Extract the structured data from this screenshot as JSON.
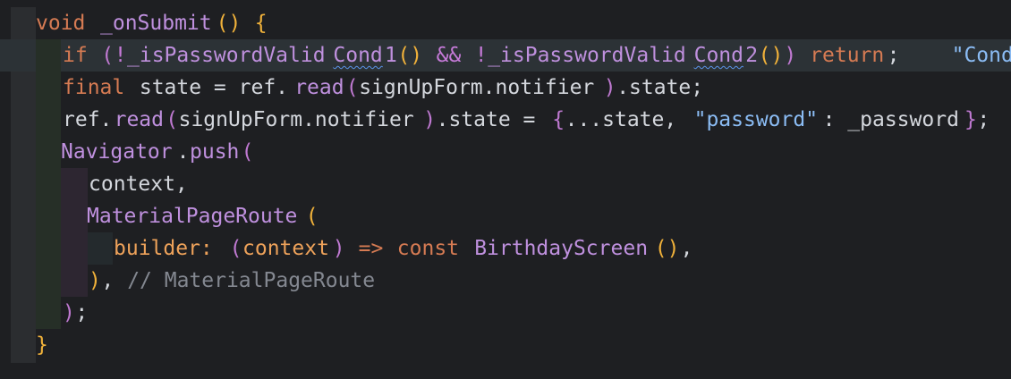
{
  "editor": {
    "lines": [
      {
        "tokens": [
          {
            "t": "void",
            "c": "kw"
          },
          {
            "t": " ",
            "c": "pn"
          },
          {
            "t": "_onSubmit",
            "c": "fn"
          },
          {
            "t": "()",
            "c": "br1"
          },
          {
            "t": " ",
            "c": "pn"
          },
          {
            "t": "{",
            "c": "br1"
          }
        ]
      },
      {
        "tokens": [
          {
            "t": "if",
            "c": "kw"
          },
          {
            "t": " ",
            "c": "pn"
          },
          {
            "t": "(",
            "c": "br2"
          },
          {
            "t": "!",
            "c": "op"
          },
          {
            "t": "_isPasswordValid",
            "c": "fn"
          },
          {
            "t": "Cond",
            "c": "fn squig"
          },
          {
            "t": "1",
            "c": "fn"
          },
          {
            "t": "()",
            "c": "br1"
          },
          {
            "t": " ",
            "c": "pn"
          },
          {
            "t": "&&",
            "c": "op"
          },
          {
            "t": " ",
            "c": "pn"
          },
          {
            "t": "!",
            "c": "op"
          },
          {
            "t": "_isPasswordValid",
            "c": "fn"
          },
          {
            "t": "Cond",
            "c": "fn squig"
          },
          {
            "t": "2",
            "c": "fn"
          },
          {
            "t": "()",
            "c": "br1"
          },
          {
            "t": ")",
            "c": "br2"
          },
          {
            "t": " ",
            "c": "pn"
          },
          {
            "t": "return",
            "c": "kw"
          },
          {
            "t": ";",
            "c": "pn"
          },
          {
            "t": "    ",
            "c": "pn"
          },
          {
            "t": "\"Cond",
            "c": "str"
          }
        ]
      },
      {
        "tokens": [
          {
            "t": "final",
            "c": "kw"
          },
          {
            "t": " state = ref.",
            "c": "pn"
          },
          {
            "t": "read",
            "c": "fn"
          },
          {
            "t": "(",
            "c": "br2"
          },
          {
            "t": "signUpForm.notifier",
            "c": "pn"
          },
          {
            "t": ")",
            "c": "br2"
          },
          {
            "t": ".state;",
            "c": "pn"
          }
        ]
      },
      {
        "tokens": [
          {
            "t": "ref.",
            "c": "pn"
          },
          {
            "t": "read",
            "c": "fn"
          },
          {
            "t": "(",
            "c": "br2"
          },
          {
            "t": "signUpForm.notifier",
            "c": "pn"
          },
          {
            "t": ")",
            "c": "br2"
          },
          {
            "t": ".state = ",
            "c": "pn"
          },
          {
            "t": "{",
            "c": "br2"
          },
          {
            "t": "...state, ",
            "c": "pn"
          },
          {
            "t": "\"password\"",
            "c": "str"
          },
          {
            "t": ": _password",
            "c": "pn"
          },
          {
            "t": "}",
            "c": "br2"
          },
          {
            "t": ";",
            "c": "pn"
          }
        ]
      },
      {
        "tokens": [
          {
            "t": "Navigator",
            "c": "fn"
          },
          {
            "t": ".",
            "c": "pn"
          },
          {
            "t": "push",
            "c": "fn"
          },
          {
            "t": "(",
            "c": "br2"
          }
        ]
      },
      {
        "tokens": [
          {
            "t": "context,",
            "c": "pn"
          }
        ]
      },
      {
        "tokens": [
          {
            "t": "MaterialPageRoute",
            "c": "fn"
          },
          {
            "t": "(",
            "c": "br1"
          }
        ]
      },
      {
        "tokens": [
          {
            "t": "builder: ",
            "c": "param"
          },
          {
            "t": "(",
            "c": "br2"
          },
          {
            "t": "context",
            "c": "param"
          },
          {
            "t": ")",
            "c": "br2"
          },
          {
            "t": " ",
            "c": "pn"
          },
          {
            "t": "=>",
            "c": "kw"
          },
          {
            "t": " ",
            "c": "pn"
          },
          {
            "t": "const",
            "c": "kw"
          },
          {
            "t": " ",
            "c": "pn"
          },
          {
            "t": "BirthdayScreen",
            "c": "fn"
          },
          {
            "t": "()",
            "c": "br1"
          },
          {
            "t": ",",
            "c": "pn"
          }
        ]
      },
      {
        "tokens": [
          {
            "t": ")",
            "c": "br1"
          },
          {
            "t": ", ",
            "c": "pn"
          },
          {
            "t": "// MaterialPageRoute",
            "c": "cm"
          }
        ]
      },
      {
        "tokens": [
          {
            "t": ")",
            "c": "br2"
          },
          {
            "t": ";",
            "c": "pn"
          }
        ]
      },
      {
        "tokens": [
          {
            "t": "}",
            "c": "br1"
          }
        ]
      }
    ]
  }
}
